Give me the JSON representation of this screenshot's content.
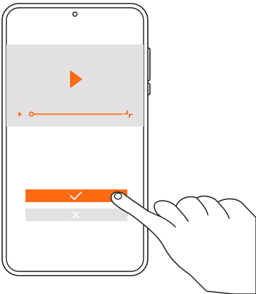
{
  "colors": {
    "accent": "#ff6a13",
    "video_background": "#e3e1e3",
    "cancel_button": "#e3e1e3",
    "outline": "#1c1c1c",
    "screen": "#ffffff"
  },
  "icons": {
    "play": "play-icon",
    "confirm": "checkmark-icon",
    "cancel": "close-icon",
    "fullscreen": "fullscreen-icon",
    "small_play": "small-play-icon",
    "camera": "front-camera-icon"
  },
  "video": {
    "progress": 0.02
  }
}
